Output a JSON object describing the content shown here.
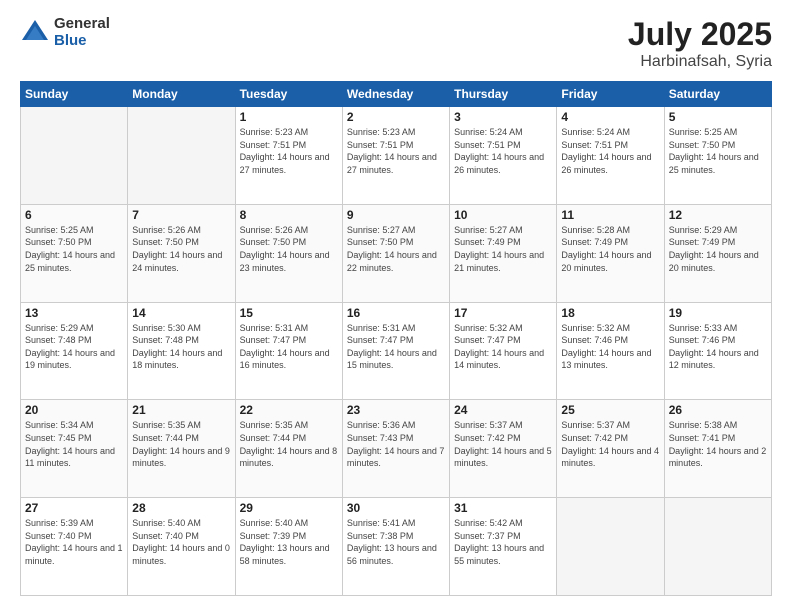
{
  "header": {
    "logo_general": "General",
    "logo_blue": "Blue",
    "title": "July 2025",
    "subtitle": "Harbinafsah, Syria"
  },
  "weekdays": [
    "Sunday",
    "Monday",
    "Tuesday",
    "Wednesday",
    "Thursday",
    "Friday",
    "Saturday"
  ],
  "weeks": [
    [
      {
        "day": "",
        "sunrise": "",
        "sunset": "",
        "daylight": "",
        "empty": true
      },
      {
        "day": "",
        "sunrise": "",
        "sunset": "",
        "daylight": "",
        "empty": true
      },
      {
        "day": "1",
        "sunrise": "Sunrise: 5:23 AM",
        "sunset": "Sunset: 7:51 PM",
        "daylight": "Daylight: 14 hours and 27 minutes.",
        "empty": false
      },
      {
        "day": "2",
        "sunrise": "Sunrise: 5:23 AM",
        "sunset": "Sunset: 7:51 PM",
        "daylight": "Daylight: 14 hours and 27 minutes.",
        "empty": false
      },
      {
        "day": "3",
        "sunrise": "Sunrise: 5:24 AM",
        "sunset": "Sunset: 7:51 PM",
        "daylight": "Daylight: 14 hours and 26 minutes.",
        "empty": false
      },
      {
        "day": "4",
        "sunrise": "Sunrise: 5:24 AM",
        "sunset": "Sunset: 7:51 PM",
        "daylight": "Daylight: 14 hours and 26 minutes.",
        "empty": false
      },
      {
        "day": "5",
        "sunrise": "Sunrise: 5:25 AM",
        "sunset": "Sunset: 7:50 PM",
        "daylight": "Daylight: 14 hours and 25 minutes.",
        "empty": false
      }
    ],
    [
      {
        "day": "6",
        "sunrise": "Sunrise: 5:25 AM",
        "sunset": "Sunset: 7:50 PM",
        "daylight": "Daylight: 14 hours and 25 minutes.",
        "empty": false
      },
      {
        "day": "7",
        "sunrise": "Sunrise: 5:26 AM",
        "sunset": "Sunset: 7:50 PM",
        "daylight": "Daylight: 14 hours and 24 minutes.",
        "empty": false
      },
      {
        "day": "8",
        "sunrise": "Sunrise: 5:26 AM",
        "sunset": "Sunset: 7:50 PM",
        "daylight": "Daylight: 14 hours and 23 minutes.",
        "empty": false
      },
      {
        "day": "9",
        "sunrise": "Sunrise: 5:27 AM",
        "sunset": "Sunset: 7:50 PM",
        "daylight": "Daylight: 14 hours and 22 minutes.",
        "empty": false
      },
      {
        "day": "10",
        "sunrise": "Sunrise: 5:27 AM",
        "sunset": "Sunset: 7:49 PM",
        "daylight": "Daylight: 14 hours and 21 minutes.",
        "empty": false
      },
      {
        "day": "11",
        "sunrise": "Sunrise: 5:28 AM",
        "sunset": "Sunset: 7:49 PM",
        "daylight": "Daylight: 14 hours and 20 minutes.",
        "empty": false
      },
      {
        "day": "12",
        "sunrise": "Sunrise: 5:29 AM",
        "sunset": "Sunset: 7:49 PM",
        "daylight": "Daylight: 14 hours and 20 minutes.",
        "empty": false
      }
    ],
    [
      {
        "day": "13",
        "sunrise": "Sunrise: 5:29 AM",
        "sunset": "Sunset: 7:48 PM",
        "daylight": "Daylight: 14 hours and 19 minutes.",
        "empty": false
      },
      {
        "day": "14",
        "sunrise": "Sunrise: 5:30 AM",
        "sunset": "Sunset: 7:48 PM",
        "daylight": "Daylight: 14 hours and 18 minutes.",
        "empty": false
      },
      {
        "day": "15",
        "sunrise": "Sunrise: 5:31 AM",
        "sunset": "Sunset: 7:47 PM",
        "daylight": "Daylight: 14 hours and 16 minutes.",
        "empty": false
      },
      {
        "day": "16",
        "sunrise": "Sunrise: 5:31 AM",
        "sunset": "Sunset: 7:47 PM",
        "daylight": "Daylight: 14 hours and 15 minutes.",
        "empty": false
      },
      {
        "day": "17",
        "sunrise": "Sunrise: 5:32 AM",
        "sunset": "Sunset: 7:47 PM",
        "daylight": "Daylight: 14 hours and 14 minutes.",
        "empty": false
      },
      {
        "day": "18",
        "sunrise": "Sunrise: 5:32 AM",
        "sunset": "Sunset: 7:46 PM",
        "daylight": "Daylight: 14 hours and 13 minutes.",
        "empty": false
      },
      {
        "day": "19",
        "sunrise": "Sunrise: 5:33 AM",
        "sunset": "Sunset: 7:46 PM",
        "daylight": "Daylight: 14 hours and 12 minutes.",
        "empty": false
      }
    ],
    [
      {
        "day": "20",
        "sunrise": "Sunrise: 5:34 AM",
        "sunset": "Sunset: 7:45 PM",
        "daylight": "Daylight: 14 hours and 11 minutes.",
        "empty": false
      },
      {
        "day": "21",
        "sunrise": "Sunrise: 5:35 AM",
        "sunset": "Sunset: 7:44 PM",
        "daylight": "Daylight: 14 hours and 9 minutes.",
        "empty": false
      },
      {
        "day": "22",
        "sunrise": "Sunrise: 5:35 AM",
        "sunset": "Sunset: 7:44 PM",
        "daylight": "Daylight: 14 hours and 8 minutes.",
        "empty": false
      },
      {
        "day": "23",
        "sunrise": "Sunrise: 5:36 AM",
        "sunset": "Sunset: 7:43 PM",
        "daylight": "Daylight: 14 hours and 7 minutes.",
        "empty": false
      },
      {
        "day": "24",
        "sunrise": "Sunrise: 5:37 AM",
        "sunset": "Sunset: 7:42 PM",
        "daylight": "Daylight: 14 hours and 5 minutes.",
        "empty": false
      },
      {
        "day": "25",
        "sunrise": "Sunrise: 5:37 AM",
        "sunset": "Sunset: 7:42 PM",
        "daylight": "Daylight: 14 hours and 4 minutes.",
        "empty": false
      },
      {
        "day": "26",
        "sunrise": "Sunrise: 5:38 AM",
        "sunset": "Sunset: 7:41 PM",
        "daylight": "Daylight: 14 hours and 2 minutes.",
        "empty": false
      }
    ],
    [
      {
        "day": "27",
        "sunrise": "Sunrise: 5:39 AM",
        "sunset": "Sunset: 7:40 PM",
        "daylight": "Daylight: 14 hours and 1 minute.",
        "empty": false
      },
      {
        "day": "28",
        "sunrise": "Sunrise: 5:40 AM",
        "sunset": "Sunset: 7:40 PM",
        "daylight": "Daylight: 14 hours and 0 minutes.",
        "empty": false
      },
      {
        "day": "29",
        "sunrise": "Sunrise: 5:40 AM",
        "sunset": "Sunset: 7:39 PM",
        "daylight": "Daylight: 13 hours and 58 minutes.",
        "empty": false
      },
      {
        "day": "30",
        "sunrise": "Sunrise: 5:41 AM",
        "sunset": "Sunset: 7:38 PM",
        "daylight": "Daylight: 13 hours and 56 minutes.",
        "empty": false
      },
      {
        "day": "31",
        "sunrise": "Sunrise: 5:42 AM",
        "sunset": "Sunset: 7:37 PM",
        "daylight": "Daylight: 13 hours and 55 minutes.",
        "empty": false
      },
      {
        "day": "",
        "sunrise": "",
        "sunset": "",
        "daylight": "",
        "empty": true
      },
      {
        "day": "",
        "sunrise": "",
        "sunset": "",
        "daylight": "",
        "empty": true
      }
    ]
  ]
}
